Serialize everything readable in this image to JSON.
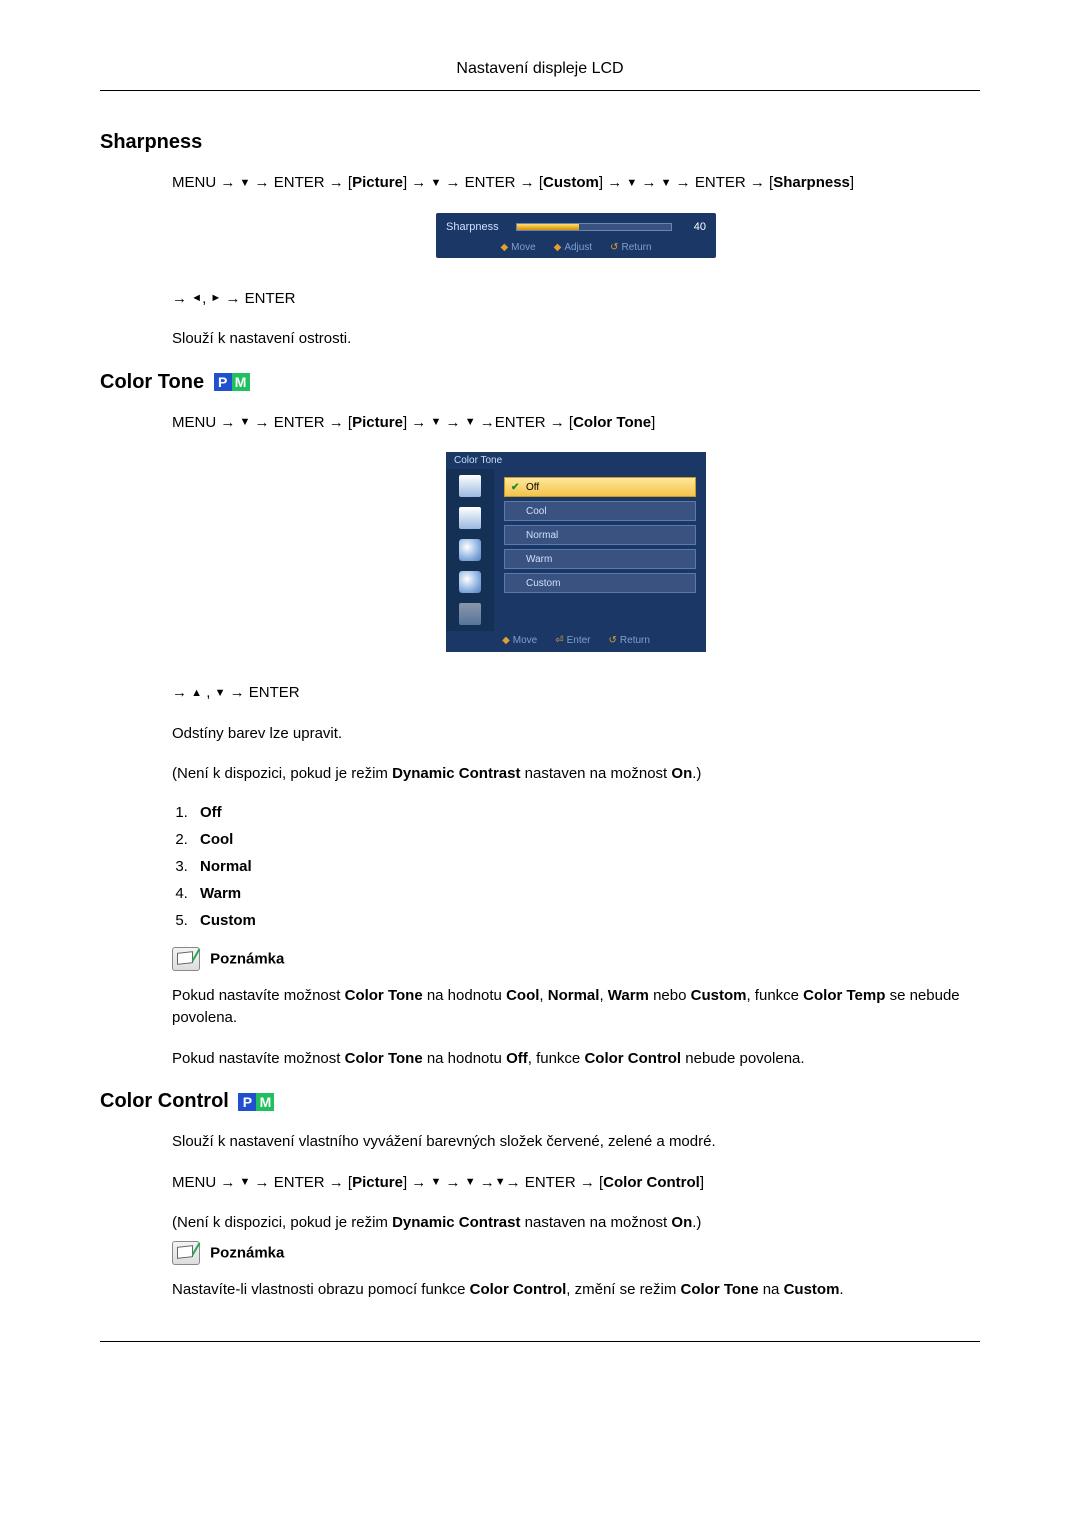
{
  "header": {
    "title": "Nastavení displeje LCD"
  },
  "sharpness": {
    "title": "Sharpness",
    "path_prefix": "MENU → ",
    "path_enter1": " → ENTER → [",
    "path_picture": "Picture",
    "path_mid1": "] → ",
    "path_enter2": " → ENTER → [",
    "path_custom": "Custom",
    "path_mid2": "] → ",
    "path_enter3": " → ENTER → [",
    "path_sharp": "Sharpness",
    "path_close": "]",
    "osd": {
      "label": "Sharpness",
      "value": "40",
      "move": "Move",
      "adjust": "Adjust",
      "return": "Return"
    },
    "arrow2_enter": " → ENTER",
    "desc": "Slouží k nastavení ostrosti."
  },
  "colortone": {
    "title": "Color Tone",
    "path_prefix": "MENU → ",
    "path_enter1": " → ENTER → [",
    "path_picture": "Picture",
    "path_mid1": "] → ",
    "path_mid2": " →ENTER → [",
    "path_ct": "Color Tone",
    "path_close": "]",
    "osd": {
      "title": "Color Tone",
      "opts": {
        "off": "Off",
        "cool": "Cool",
        "normal": "Normal",
        "warm": "Warm",
        "custom": "Custom"
      },
      "move": "Move",
      "enter": "Enter",
      "return": "Return"
    },
    "arrow2_enter": " → ENTER",
    "desc1": "Odstíny barev lze upravit.",
    "desc2_a": "(Není k dispozici, pokud je režim ",
    "desc2_b": "Dynamic Contrast",
    "desc2_c": " nastaven na možnost ",
    "desc2_d": "On",
    "desc2_e": ".)",
    "list": {
      "1": "Off",
      "2": "Cool",
      "3": "Normal",
      "4": "Warm",
      "5": "Custom"
    },
    "note_label": "Poznámka",
    "note_p1_a": "Pokud nastavíte možnost ",
    "note_p1_b": "Color Tone",
    "note_p1_c": " na hodnotu ",
    "note_p1_d": "Cool",
    "note_p1_e": ", ",
    "note_p1_f": "Normal",
    "note_p1_g": ", ",
    "note_p1_h": "Warm",
    "note_p1_i": " nebo ",
    "note_p1_j": "Custom",
    "note_p1_k": ", funkce ",
    "note_p1_l": "Color Temp",
    "note_p1_m": " se nebude povolena.",
    "note_p2_a": "Pokud nastavíte možnost ",
    "note_p2_b": "Color Tone",
    "note_p2_c": " na hodnotu ",
    "note_p2_d": "Off",
    "note_p2_e": ", funkce ",
    "note_p2_f": "Color Control",
    "note_p2_g": " nebude povolena."
  },
  "colorcontrol": {
    "title": "Color Control",
    "desc1": "Slouží k nastavení vlastního vyvážení barevných složek červené, zelené a modré.",
    "path_prefix": "MENU → ",
    "path_enter1": " → ENTER → [",
    "path_picture": "Picture",
    "path_mid1": "] → ",
    "path_enter2": "→ ENTER → [",
    "path_cc": "Color Control",
    "path_close": "]",
    "desc2_a": "(Není k dispozici, pokud je režim ",
    "desc2_b": "Dynamic Contrast",
    "desc2_c": " nastaven na možnost ",
    "desc2_d": "On",
    "desc2_e": ".)",
    "note_label": "Poznámka",
    "note_p_a": "Nastavíte-li vlastnosti obrazu pomocí funkce ",
    "note_p_b": "Color Control",
    "note_p_c": ", změní se režim ",
    "note_p_d": "Color Tone",
    "note_p_e": " na ",
    "note_p_f": "Custom",
    "note_p_g": "."
  },
  "glyphs": {
    "down": "▼",
    "up": "▲",
    "left": "◄",
    "right": "►",
    "arrow": "→",
    "diamond": "◆",
    "enterkey": "⏎",
    "returnkey": "↺"
  }
}
